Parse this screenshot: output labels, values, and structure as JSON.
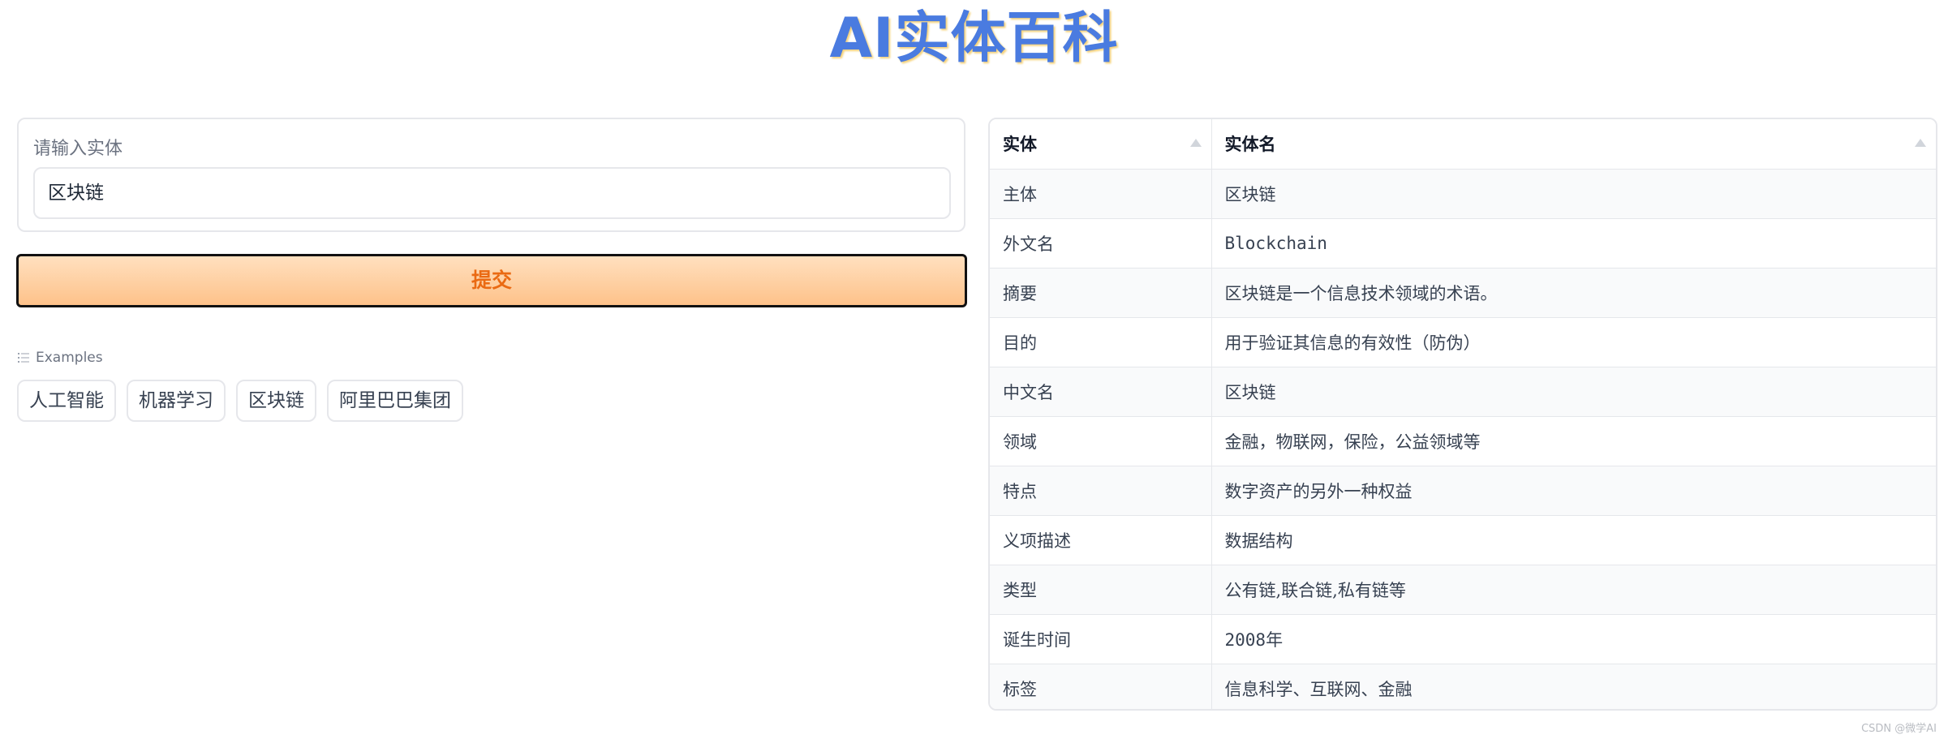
{
  "title": "AI实体百科",
  "input": {
    "label": "请输入实体",
    "value": "区块链"
  },
  "submit_label": "提交",
  "examples": {
    "heading": "Examples",
    "items": [
      "人工智能",
      "机器学习",
      "区块链",
      "阿里巴巴集团"
    ]
  },
  "table": {
    "headers": [
      "实体",
      "实体名"
    ],
    "rows": [
      [
        "主体",
        "区块链"
      ],
      [
        "外文名",
        "Blockchain"
      ],
      [
        "摘要",
        "区块链是一个信息技术领域的术语。"
      ],
      [
        "目的",
        "用于验证其信息的有效性（防伪）"
      ],
      [
        "中文名",
        "区块链"
      ],
      [
        "领域",
        "金融，物联网，保险，公益领域等"
      ],
      [
        "特点",
        "数字资产的另外一种权益"
      ],
      [
        "义项描述",
        "数据结构"
      ],
      [
        "类型",
        "公有链,联合链,私有链等"
      ],
      [
        "诞生时间",
        "2008年"
      ],
      [
        "标签",
        "信息科学、互联网、金融"
      ]
    ]
  },
  "watermark": "CSDN @微学AI",
  "colors": {
    "title": "#4a7be0",
    "submit_text": "#ea6a13",
    "submit_bg_top": "#ffe0bf",
    "submit_bg_bottom": "#fec28a"
  }
}
